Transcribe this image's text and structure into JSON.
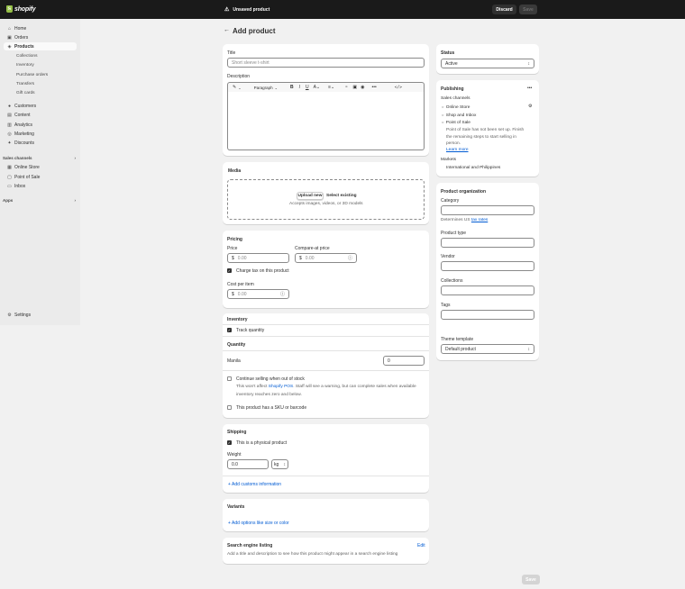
{
  "topbar": {
    "brand": "shopify",
    "status": "Unsaved product",
    "discard_label": "Discard",
    "save_label": "Save"
  },
  "sidebar": {
    "items": [
      {
        "label": "Home",
        "icon": "home-icon"
      },
      {
        "label": "Orders",
        "icon": "orders-icon"
      },
      {
        "label": "Products",
        "icon": "tag-icon"
      },
      {
        "label": "Customers",
        "icon": "person-icon"
      },
      {
        "label": "Content",
        "icon": "content-icon"
      },
      {
        "label": "Analytics",
        "icon": "chart-icon"
      },
      {
        "label": "Marketing",
        "icon": "target-icon"
      },
      {
        "label": "Discounts",
        "icon": "discount-icon"
      }
    ],
    "product_subitems": [
      "Collections",
      "Inventory",
      "Purchase orders",
      "Transfers",
      "Gift cards"
    ],
    "sales_channels_heading": "Sales channels",
    "channels": [
      {
        "label": "Online Store",
        "icon": "store-icon"
      },
      {
        "label": "Point of Sale",
        "icon": "pos-icon"
      },
      {
        "label": "Inbox",
        "icon": "inbox-icon"
      }
    ],
    "apps_heading": "Apps",
    "settings_label": "Settings"
  },
  "page": {
    "title": "Add product"
  },
  "details": {
    "title_label": "Title",
    "title_placeholder": "Short sleeve t-shirt",
    "description_label": "Description",
    "paragraph_label": "Paragraph"
  },
  "media": {
    "heading": "Media",
    "upload_label": "Upload new",
    "select_label": "Select existing",
    "accepts": "Accepts images, videos, or 3D models"
  },
  "pricing": {
    "heading": "Pricing",
    "price_label": "Price",
    "compare_label": "Compare-at price",
    "currency": "$",
    "price_value": "0.00",
    "compare_value": "0.00",
    "charge_tax_label": "Charge tax on this product",
    "cost_label": "Cost per item",
    "cost_value": "0.00"
  },
  "inventory": {
    "heading": "Inventory",
    "track_label": "Track quantity",
    "quantity_heading": "Quantity",
    "location": "Manila",
    "quantity_value": "0",
    "continue_label": "Continue selling when out of stock",
    "note_a": "This won't affect ",
    "note_link": "Shopify POS",
    "note_b": ". Staff will see a warning, but can complete sales when available inventory reaches zero and below.",
    "sku_label": "This product has a SKU or barcode"
  },
  "shipping": {
    "heading": "Shipping",
    "physical_label": "This is a physical product",
    "weight_label": "Weight",
    "weight_value": "0.0",
    "weight_unit": "kg",
    "customs_label": "Add customs information"
  },
  "variants": {
    "heading": "Variants",
    "add_label": "Add options like size or color"
  },
  "seo": {
    "heading": "Search engine listing",
    "edit_label": "Edit",
    "description": "Add a title and description to see how this product might appear in a search engine listing"
  },
  "status": {
    "heading": "Status",
    "value": "Active"
  },
  "publishing": {
    "heading": "Publishing",
    "sales_channels_label": "Sales channels",
    "channels": [
      "Online Store",
      "Shop and Inbox",
      "Point of Sale"
    ],
    "pos_note": "Point of Sale has not been set up. Finish the remaining steps to start selling in person.",
    "learn_more": "Learn more",
    "markets_label": "Markets",
    "markets_value": "International and Philippines"
  },
  "organization": {
    "heading": "Product organization",
    "category_label": "Category",
    "determines_a": "Determines US ",
    "tax_rates": "tax rates",
    "type_label": "Product type",
    "vendor_label": "Vendor",
    "collections_label": "Collections",
    "tags_label": "Tags"
  },
  "theme": {
    "heading": "Theme template",
    "value": "Default product"
  },
  "footer": {
    "save_label": "Save"
  }
}
